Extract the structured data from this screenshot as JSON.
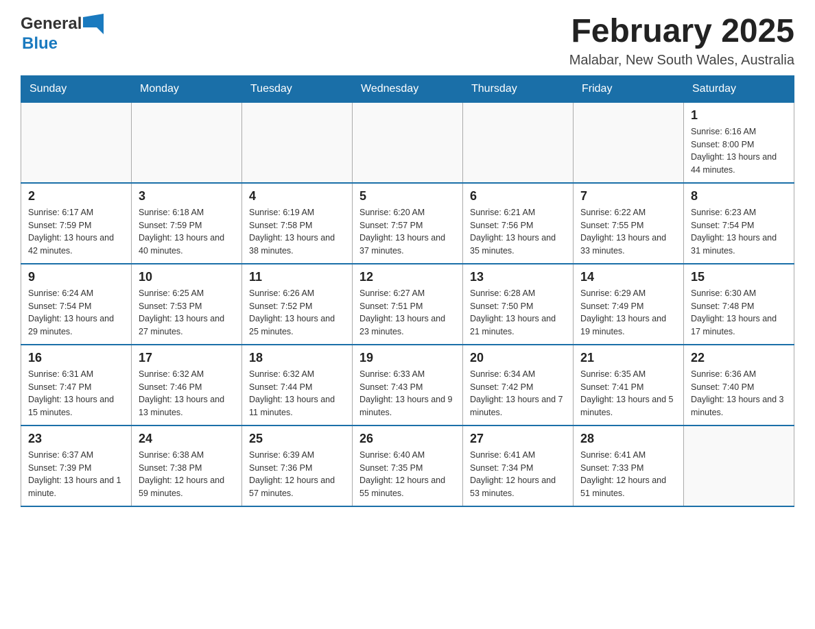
{
  "header": {
    "logo_general": "General",
    "logo_blue": "Blue",
    "title": "February 2025",
    "subtitle": "Malabar, New South Wales, Australia"
  },
  "days_of_week": [
    "Sunday",
    "Monday",
    "Tuesday",
    "Wednesday",
    "Thursday",
    "Friday",
    "Saturday"
  ],
  "weeks": [
    [
      {
        "day": "",
        "info": ""
      },
      {
        "day": "",
        "info": ""
      },
      {
        "day": "",
        "info": ""
      },
      {
        "day": "",
        "info": ""
      },
      {
        "day": "",
        "info": ""
      },
      {
        "day": "",
        "info": ""
      },
      {
        "day": "1",
        "info": "Sunrise: 6:16 AM\nSunset: 8:00 PM\nDaylight: 13 hours and 44 minutes."
      }
    ],
    [
      {
        "day": "2",
        "info": "Sunrise: 6:17 AM\nSunset: 7:59 PM\nDaylight: 13 hours and 42 minutes."
      },
      {
        "day": "3",
        "info": "Sunrise: 6:18 AM\nSunset: 7:59 PM\nDaylight: 13 hours and 40 minutes."
      },
      {
        "day": "4",
        "info": "Sunrise: 6:19 AM\nSunset: 7:58 PM\nDaylight: 13 hours and 38 minutes."
      },
      {
        "day": "5",
        "info": "Sunrise: 6:20 AM\nSunset: 7:57 PM\nDaylight: 13 hours and 37 minutes."
      },
      {
        "day": "6",
        "info": "Sunrise: 6:21 AM\nSunset: 7:56 PM\nDaylight: 13 hours and 35 minutes."
      },
      {
        "day": "7",
        "info": "Sunrise: 6:22 AM\nSunset: 7:55 PM\nDaylight: 13 hours and 33 minutes."
      },
      {
        "day": "8",
        "info": "Sunrise: 6:23 AM\nSunset: 7:54 PM\nDaylight: 13 hours and 31 minutes."
      }
    ],
    [
      {
        "day": "9",
        "info": "Sunrise: 6:24 AM\nSunset: 7:54 PM\nDaylight: 13 hours and 29 minutes."
      },
      {
        "day": "10",
        "info": "Sunrise: 6:25 AM\nSunset: 7:53 PM\nDaylight: 13 hours and 27 minutes."
      },
      {
        "day": "11",
        "info": "Sunrise: 6:26 AM\nSunset: 7:52 PM\nDaylight: 13 hours and 25 minutes."
      },
      {
        "day": "12",
        "info": "Sunrise: 6:27 AM\nSunset: 7:51 PM\nDaylight: 13 hours and 23 minutes."
      },
      {
        "day": "13",
        "info": "Sunrise: 6:28 AM\nSunset: 7:50 PM\nDaylight: 13 hours and 21 minutes."
      },
      {
        "day": "14",
        "info": "Sunrise: 6:29 AM\nSunset: 7:49 PM\nDaylight: 13 hours and 19 minutes."
      },
      {
        "day": "15",
        "info": "Sunrise: 6:30 AM\nSunset: 7:48 PM\nDaylight: 13 hours and 17 minutes."
      }
    ],
    [
      {
        "day": "16",
        "info": "Sunrise: 6:31 AM\nSunset: 7:47 PM\nDaylight: 13 hours and 15 minutes."
      },
      {
        "day": "17",
        "info": "Sunrise: 6:32 AM\nSunset: 7:46 PM\nDaylight: 13 hours and 13 minutes."
      },
      {
        "day": "18",
        "info": "Sunrise: 6:32 AM\nSunset: 7:44 PM\nDaylight: 13 hours and 11 minutes."
      },
      {
        "day": "19",
        "info": "Sunrise: 6:33 AM\nSunset: 7:43 PM\nDaylight: 13 hours and 9 minutes."
      },
      {
        "day": "20",
        "info": "Sunrise: 6:34 AM\nSunset: 7:42 PM\nDaylight: 13 hours and 7 minutes."
      },
      {
        "day": "21",
        "info": "Sunrise: 6:35 AM\nSunset: 7:41 PM\nDaylight: 13 hours and 5 minutes."
      },
      {
        "day": "22",
        "info": "Sunrise: 6:36 AM\nSunset: 7:40 PM\nDaylight: 13 hours and 3 minutes."
      }
    ],
    [
      {
        "day": "23",
        "info": "Sunrise: 6:37 AM\nSunset: 7:39 PM\nDaylight: 13 hours and 1 minute."
      },
      {
        "day": "24",
        "info": "Sunrise: 6:38 AM\nSunset: 7:38 PM\nDaylight: 12 hours and 59 minutes."
      },
      {
        "day": "25",
        "info": "Sunrise: 6:39 AM\nSunset: 7:36 PM\nDaylight: 12 hours and 57 minutes."
      },
      {
        "day": "26",
        "info": "Sunrise: 6:40 AM\nSunset: 7:35 PM\nDaylight: 12 hours and 55 minutes."
      },
      {
        "day": "27",
        "info": "Sunrise: 6:41 AM\nSunset: 7:34 PM\nDaylight: 12 hours and 53 minutes."
      },
      {
        "day": "28",
        "info": "Sunrise: 6:41 AM\nSunset: 7:33 PM\nDaylight: 12 hours and 51 minutes."
      },
      {
        "day": "",
        "info": ""
      }
    ]
  ]
}
